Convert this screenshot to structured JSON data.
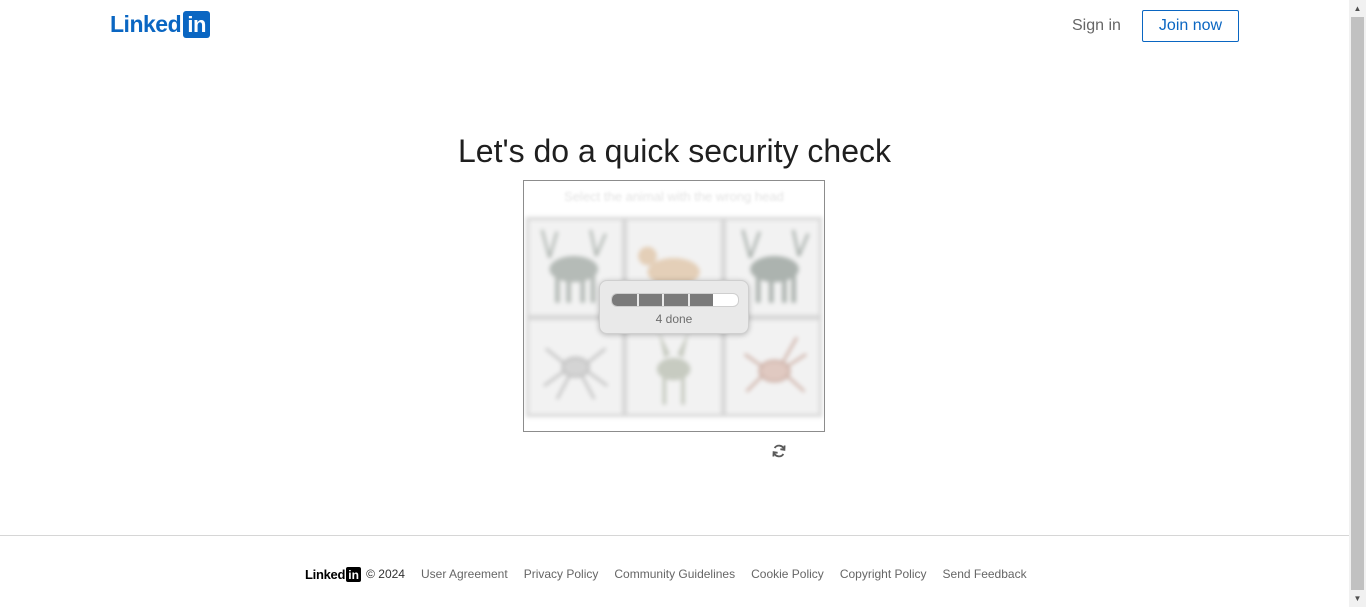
{
  "header": {
    "logo_word": "Linked",
    "logo_box": "in",
    "sign_in_label": "Sign in",
    "join_now_label": "Join now"
  },
  "main": {
    "title": "Let's do a quick security check",
    "captcha": {
      "prompt": "Select the animal with the wrong head",
      "progress_done": 4,
      "progress_total": 5,
      "progress_text": "4 done",
      "refresh_icon": "refresh-icon"
    }
  },
  "footer": {
    "logo_word": "Linked",
    "logo_box": "in",
    "copyright": "© 2024",
    "links": [
      "User Agreement",
      "Privacy Policy",
      "Community Guidelines",
      "Cookie Policy",
      "Copyright Policy",
      "Send Feedback"
    ]
  },
  "colors": {
    "brand": "#0a66c2",
    "progress_fill": "#7a7a7a"
  }
}
